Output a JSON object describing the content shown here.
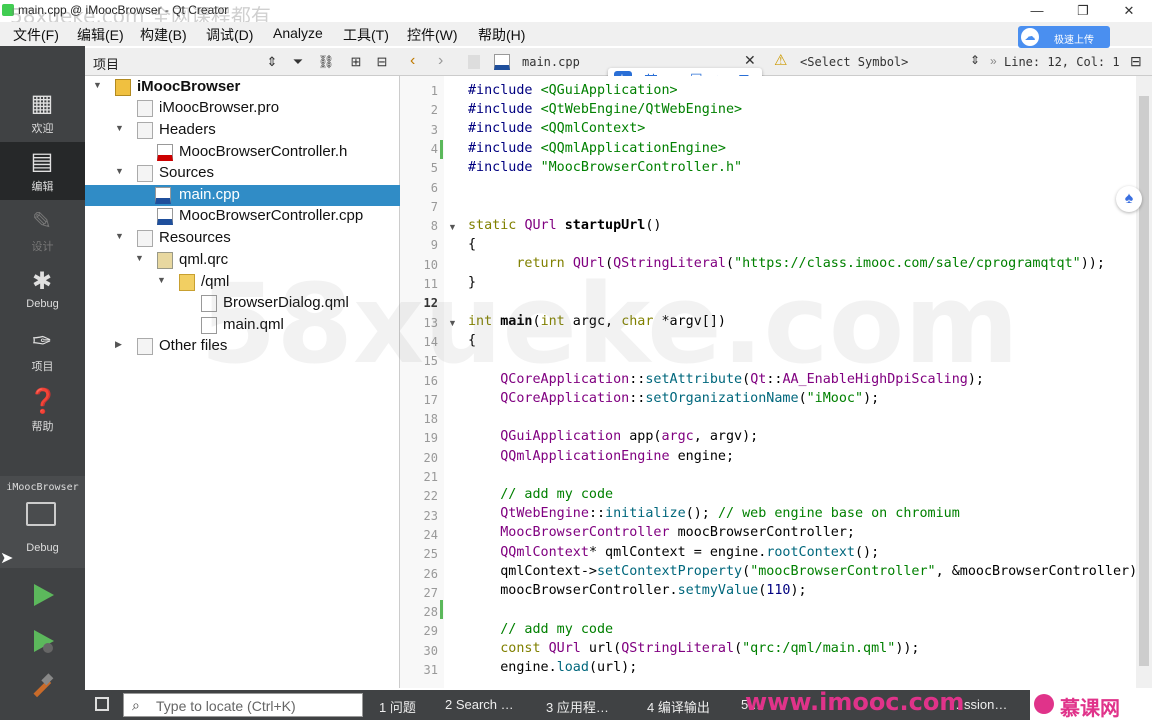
{
  "window": {
    "title": "main.cpp @ iMoocBrowser - Qt Creator",
    "watermark_top": "58xueke.com 全网课程都有",
    "min": "—",
    "max": "❐",
    "close": "✕"
  },
  "menu": [
    "文件(F)",
    "编辑(E)",
    "构建(B)",
    "调试(D)",
    "Analyze",
    "工具(T)",
    "控件(W)",
    "帮助(H)"
  ],
  "upload_button": "极速上传",
  "modes": [
    {
      "label": "欢迎",
      "icon": "grid-icon"
    },
    {
      "label": "编辑",
      "icon": "edit-icon"
    },
    {
      "label": "设计",
      "icon": "pencil-icon"
    },
    {
      "label": "Debug",
      "icon": "bug-icon"
    },
    {
      "label": "项目",
      "icon": "wrench-icon"
    },
    {
      "label": "帮助",
      "icon": "help-icon"
    }
  ],
  "kit": {
    "project": "iMoocBrowser",
    "config": "Debug"
  },
  "sidebar": {
    "title": "项目"
  },
  "tree": {
    "project": "iMoocBrowser",
    "pro_file": "iMoocBrowser.pro",
    "headers": "Headers",
    "header_file": "MoocBrowserController.h",
    "sources": "Sources",
    "main_cpp": "main.cpp",
    "controller_cpp": "MoocBrowserController.cpp",
    "resources": "Resources",
    "qrc": "qml.qrc",
    "qml_folder": "/qml",
    "dialog_qml": "BrowserDialog.qml",
    "main_qml": "main.qml",
    "other": "Other files"
  },
  "editor": {
    "filename": "main.cpp",
    "select_symbol": "<Select Symbol>",
    "position": "Line: 12, Col: 1",
    "ime_items": [
      "英",
      "•,",
      "☐",
      "♠",
      "⊞"
    ]
  },
  "line_numbers": [
    "1",
    "2",
    "3",
    "4",
    "5",
    "6",
    "7",
    "8",
    "9",
    "10",
    "11",
    "12",
    "13",
    "14",
    "15",
    "16",
    "17",
    "18",
    "19",
    "20",
    "21",
    "22",
    "23",
    "24",
    "25",
    "26",
    "27",
    "28",
    "29",
    "30",
    "31"
  ],
  "status": {
    "locator_placeholder": "Type to locate (Ctrl+K)",
    "panes": [
      "1 问题",
      "2 Search …",
      "3 应用程…",
      "4 编译输出",
      "5 …",
      "…ssion…"
    ]
  },
  "watermarks": {
    "center": "58xueke.com",
    "bottom": "www.imooc.com",
    "brand": "慕课网"
  }
}
